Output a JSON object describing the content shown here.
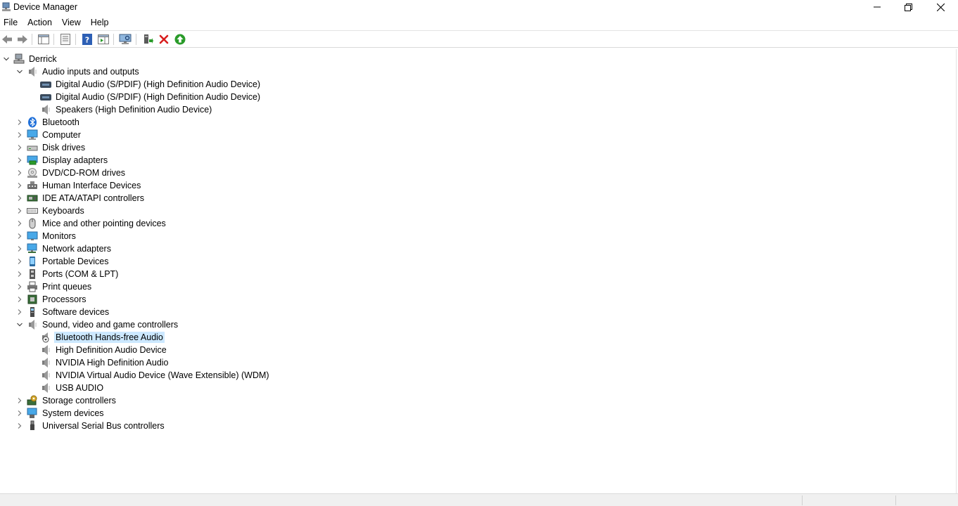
{
  "window": {
    "title": "Device Manager"
  },
  "menu": [
    "File",
    "Action",
    "View",
    "Help"
  ],
  "toolbar": {
    "buttons": [
      {
        "name": "back-icon"
      },
      {
        "name": "forward-icon"
      },
      {
        "name": "show-hide-console-tree-icon"
      },
      {
        "name": "properties-icon"
      },
      {
        "name": "help-icon"
      },
      {
        "name": "show-action-pane-icon"
      },
      {
        "name": "scan-hardware-changes-icon"
      },
      {
        "name": "add-driver-icon"
      },
      {
        "name": "uninstall-device-icon"
      },
      {
        "name": "update-driver-icon"
      }
    ]
  },
  "tree": {
    "root": "Derrick",
    "rows": [
      {
        "label": "Derrick",
        "level": 0,
        "expander": "open",
        "icon": "computer-root-icon"
      },
      {
        "label": "Audio inputs and outputs",
        "level": 1,
        "expander": "open",
        "icon": "speaker-icon"
      },
      {
        "label": "Digital Audio (S/PDIF) (High Definition Audio Device)",
        "level": 2,
        "expander": "none",
        "icon": "spdif-port-icon"
      },
      {
        "label": "Digital Audio (S/PDIF) (High Definition Audio Device)",
        "level": 2,
        "expander": "none",
        "icon": "spdif-port-icon"
      },
      {
        "label": "Speakers (High Definition Audio Device)",
        "level": 2,
        "expander": "none",
        "icon": "speaker-icon"
      },
      {
        "label": "Bluetooth",
        "level": 1,
        "expander": "closed",
        "icon": "bluetooth-icon"
      },
      {
        "label": "Computer",
        "level": 1,
        "expander": "closed",
        "icon": "computer-icon"
      },
      {
        "label": "Disk drives",
        "level": 1,
        "expander": "closed",
        "icon": "disk-drive-icon"
      },
      {
        "label": "Display adapters",
        "level": 1,
        "expander": "closed",
        "icon": "display-adapter-icon"
      },
      {
        "label": "DVD/CD-ROM drives",
        "level": 1,
        "expander": "closed",
        "icon": "dvd-drive-icon"
      },
      {
        "label": "Human Interface Devices",
        "level": 1,
        "expander": "closed",
        "icon": "hid-icon"
      },
      {
        "label": "IDE ATA/ATAPI controllers",
        "level": 1,
        "expander": "closed",
        "icon": "ide-controller-icon"
      },
      {
        "label": "Keyboards",
        "level": 1,
        "expander": "closed",
        "icon": "keyboard-icon"
      },
      {
        "label": "Mice and other pointing devices",
        "level": 1,
        "expander": "closed",
        "icon": "mouse-icon"
      },
      {
        "label": "Monitors",
        "level": 1,
        "expander": "closed",
        "icon": "monitor-icon"
      },
      {
        "label": "Network adapters",
        "level": 1,
        "expander": "closed",
        "icon": "network-adapter-icon"
      },
      {
        "label": "Portable Devices",
        "level": 1,
        "expander": "closed",
        "icon": "portable-device-icon"
      },
      {
        "label": "Ports (COM & LPT)",
        "level": 1,
        "expander": "closed",
        "icon": "port-icon"
      },
      {
        "label": "Print queues",
        "level": 1,
        "expander": "closed",
        "icon": "printer-icon"
      },
      {
        "label": "Processors",
        "level": 1,
        "expander": "closed",
        "icon": "processor-icon"
      },
      {
        "label": "Software devices",
        "level": 1,
        "expander": "closed",
        "icon": "software-device-icon"
      },
      {
        "label": "Sound, video and game controllers",
        "level": 1,
        "expander": "open",
        "icon": "speaker-icon"
      },
      {
        "label": "Bluetooth Hands-free Audio",
        "level": 2,
        "expander": "none",
        "icon": "speaker-disabled-icon",
        "selected": true
      },
      {
        "label": "High Definition Audio Device",
        "level": 2,
        "expander": "none",
        "icon": "speaker-icon"
      },
      {
        "label": "NVIDIA High Definition Audio",
        "level": 2,
        "expander": "none",
        "icon": "speaker-icon"
      },
      {
        "label": "NVIDIA Virtual Audio Device (Wave Extensible) (WDM)",
        "level": 2,
        "expander": "none",
        "icon": "speaker-icon"
      },
      {
        "label": "USB  AUDIO",
        "level": 2,
        "expander": "none",
        "icon": "speaker-icon"
      },
      {
        "label": "Storage controllers",
        "level": 1,
        "expander": "closed",
        "icon": "storage-controller-icon"
      },
      {
        "label": "System devices",
        "level": 1,
        "expander": "closed",
        "icon": "system-device-icon"
      },
      {
        "label": "Universal Serial Bus controllers",
        "level": 1,
        "expander": "closed",
        "icon": "usb-icon"
      }
    ]
  },
  "colors": {
    "selection": "#cce8ff",
    "accent_blue": "#1e6fd9",
    "uninstall_red": "#d81e1e",
    "update_green": "#2a9b2a"
  }
}
